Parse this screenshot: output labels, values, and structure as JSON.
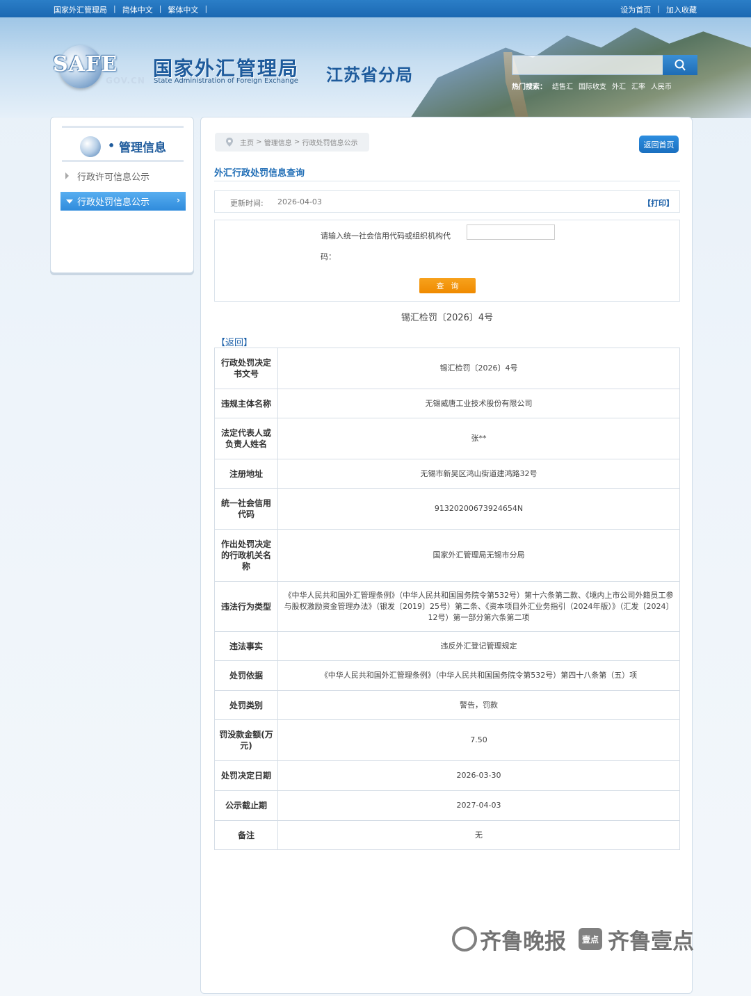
{
  "topbar": {
    "left_links": [
      "国家外汇管理局",
      "简体中文",
      "繁体中文"
    ],
    "set_home": "设为首页",
    "favorite": "加入收藏"
  },
  "header": {
    "logo_text": "SAFE",
    "gov_cn": "GOV.CN",
    "title_cn": "国家外汇管理局",
    "title_en": "State Administration of Foreign Exchange",
    "branch": "江苏省分局",
    "hot_label": "热门搜索：",
    "hot_terms": [
      "结售汇",
      "国际收支",
      "外汇",
      "汇率",
      "人民币"
    ]
  },
  "sidebar": {
    "title": "管理信息",
    "items": [
      {
        "label": "行政许可信息公示",
        "active": false
      },
      {
        "label": "行政处罚信息公示",
        "active": true
      }
    ]
  },
  "main": {
    "breadcrumb": [
      "主页",
      "管理信息",
      "行政处罚信息公示"
    ],
    "back_home": "返回首页",
    "page_title": "外汇行政处罚信息查询",
    "update_label": "更新时间:",
    "update_value": "2026-04-03",
    "print": "【打印】",
    "query_label": "请输入统一社会信用代码或组织机构代码：",
    "query_button": "查询",
    "doc_number": "锡汇检罚〔2026〕4号",
    "return_link": "【返回】",
    "rows": [
      {
        "key": "行政处罚决定书文号",
        "value": "锡汇检罚〔2026〕4号"
      },
      {
        "key": "违规主体名称",
        "value": "无锡威唐工业技术股份有限公司"
      },
      {
        "key": "法定代表人或负责人姓名",
        "value": "张**"
      },
      {
        "key": "注册地址",
        "value": "无锡市新吴区鸿山街道建鸿路32号"
      },
      {
        "key": "统一社会信用代码",
        "value": "91320200673924654N"
      },
      {
        "key": "作出处罚决定的行政机关名称",
        "value": "国家外汇管理局无锡市分局"
      },
      {
        "key": "违法行为类型",
        "value": "《中华人民共和国外汇管理条例》（中华人民共和国国务院令第532号）第十六条第二款、《境内上市公司外籍员工参与股权激励资金管理办法》（银发〔2019〕25号）第二条、《资本项目外汇业务指引（2024年版）》（汇发〔2024〕12号）第一部分第六条第二项"
      },
      {
        "key": "违法事实",
        "value": "违反外汇登记管理规定"
      },
      {
        "key": "处罚依据",
        "value": "《中华人民共和国外汇管理条例》（中华人民共和国国务院令第532号）第四十八条第（五）项"
      },
      {
        "key": "处罚类别",
        "value": "警告，罚款"
      },
      {
        "key": "罚没款金额(万元)",
        "value": "7.50"
      },
      {
        "key": "处罚决定日期",
        "value": "2026-03-30"
      },
      {
        "key": "公示截止期",
        "value": "2027-04-03"
      },
      {
        "key": "备注",
        "value": "无"
      }
    ]
  },
  "watermark": {
    "brand1": "齐鲁晚报",
    "badge": "壹点",
    "brand2": "齐鲁壹点"
  }
}
